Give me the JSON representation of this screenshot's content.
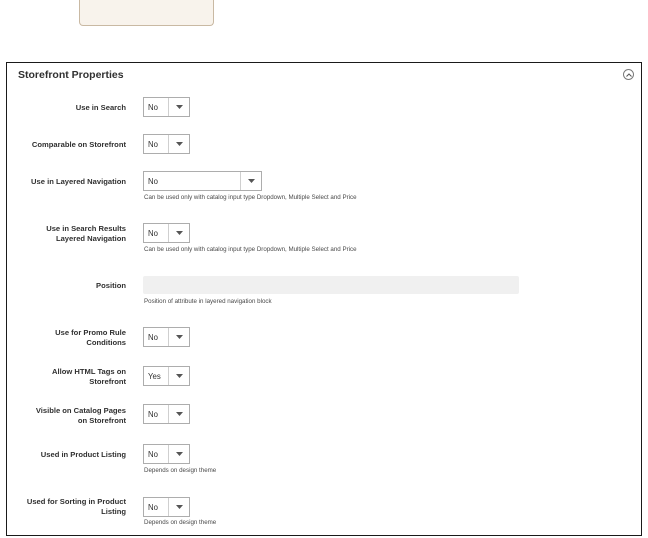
{
  "panel": {
    "title": "Storefront Properties"
  },
  "fields": {
    "use_in_search": {
      "label": "Use in Search",
      "value": "No"
    },
    "comparable": {
      "label": "Comparable on Storefront",
      "value": "No"
    },
    "layered_nav": {
      "label": "Use in Layered Navigation",
      "value": "No",
      "note": "Can be used only with catalog input type Dropdown, Multiple Select and Price"
    },
    "search_layered": {
      "label_line1": "Use in Search Results",
      "label_line2": "Layered Navigation",
      "value": "No",
      "note": "Can be used only with catalog input type Dropdown, Multiple Select and Price"
    },
    "position": {
      "label": "Position",
      "value": "",
      "note": "Position of attribute in layered navigation block"
    },
    "promo": {
      "label_line1": "Use for Promo Rule",
      "label_line2": "Conditions",
      "value": "No"
    },
    "html_tags": {
      "label_line1": "Allow HTML Tags on",
      "label_line2": "Storefront",
      "value": "Yes"
    },
    "visible_catalog": {
      "label_line1": "Visible on Catalog Pages",
      "label_line2": "on Storefront",
      "value": "No"
    },
    "product_listing": {
      "label": "Used in Product Listing",
      "value": "No",
      "note": "Depends on design theme"
    },
    "sorting": {
      "label_line1": "Used for Sorting in Product",
      "label_line2": "Listing",
      "value": "No",
      "note": "Depends on design theme"
    }
  }
}
